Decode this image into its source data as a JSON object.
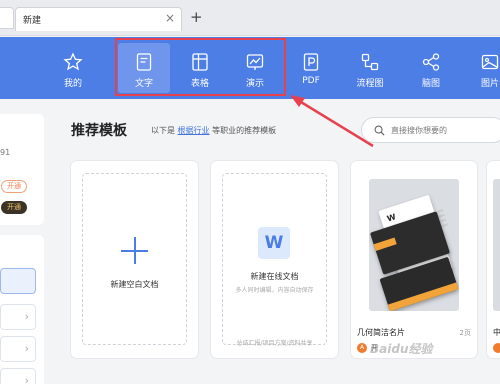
{
  "tabs": [
    {
      "label": "新建"
    }
  ],
  "toolbar": {
    "items": [
      {
        "label": "我的",
        "icon": "star-icon"
      },
      {
        "label": "文字",
        "icon": "document-icon",
        "active": true
      },
      {
        "label": "表格",
        "icon": "table-icon"
      },
      {
        "label": "演示",
        "icon": "presentation-icon"
      },
      {
        "label": "PDF",
        "icon": "pdf-icon"
      },
      {
        "label": "流程图",
        "icon": "flowchart-icon"
      },
      {
        "label": "脑图",
        "icon": "mindmap-icon"
      },
      {
        "label": "图片",
        "icon": "image-icon"
      }
    ]
  },
  "sidebar": {
    "number_text": "91",
    "open_label": "开通",
    "open_label_2": "开通"
  },
  "main": {
    "title": "推荐模板",
    "subtitle_prefix": "以下是",
    "subtitle_link": "根据行业",
    "subtitle_suffix": "等职业的推荐模板",
    "search_placeholder": "直接搜你想要的"
  },
  "cards": {
    "blank": {
      "title": "新建空白文档"
    },
    "online": {
      "title": "新建在线文档",
      "desc": "多人同时编辑，内容自动保存",
      "foot": "总结汇报/项目方案/资料共享"
    },
    "template": {
      "name": "几何简洁名片",
      "pages": "2页",
      "badge": "A",
      "open_text": "开"
    },
    "template_partial": {
      "name": "中"
    }
  },
  "watermark": "Baidu经验",
  "colors": {
    "toolbar_bg": "#4c7ee6",
    "accent": "#4b7de6",
    "highlight": "#e8414e",
    "orange": "#f07a2e"
  }
}
